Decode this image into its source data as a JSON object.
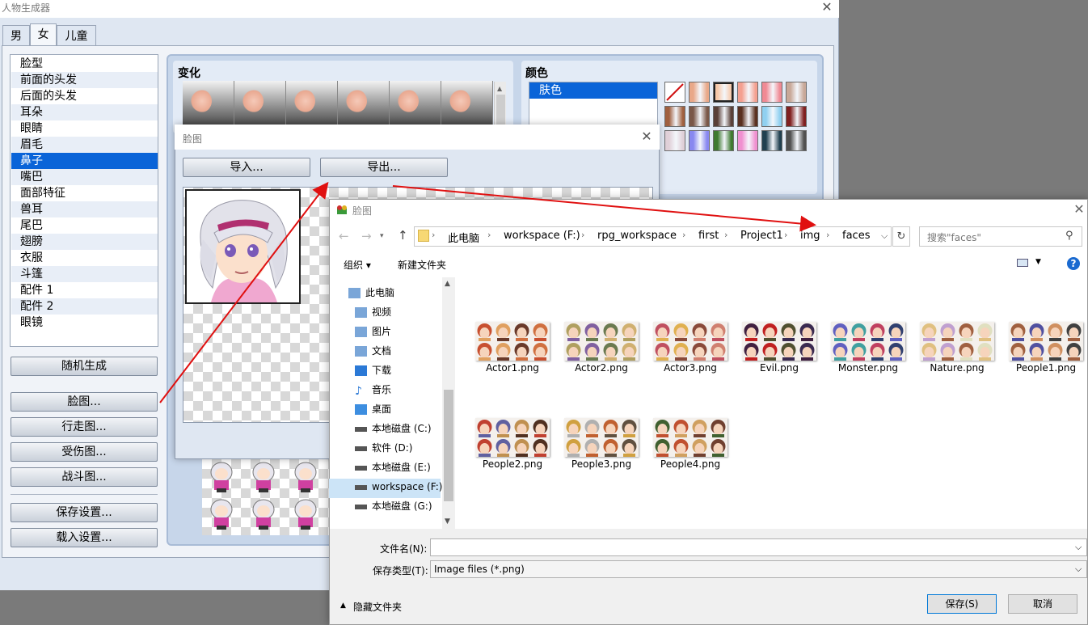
{
  "main_window": {
    "title": "人物生成器",
    "close_glyph": "✕",
    "tabs": [
      {
        "label": "男"
      },
      {
        "label": "女"
      },
      {
        "label": "儿童"
      }
    ],
    "parts": [
      "脸型",
      "前面的头发",
      "后面的头发",
      "耳朵",
      "眼睛",
      "眉毛",
      "鼻子",
      "嘴巴",
      "面部特征",
      "兽耳",
      "尾巴",
      "翅膀",
      "衣服",
      "斗篷",
      "配件 1",
      "配件 2",
      "眼镜"
    ],
    "selected_part": "鼻子",
    "buttons": {
      "random": "随机生成",
      "face": "脸图...",
      "walk": "行走图...",
      "damage": "受伤图...",
      "battle": "战斗图...",
      "save": "保存设置...",
      "load": "载入设置..."
    },
    "variation_heading": "变化",
    "color_heading": "颜色",
    "color_list_selected": "肤色",
    "swatches": [
      "#ffffff",
      "#e9a888",
      "#f7c8a8",
      "#f4a090",
      "#f08a94",
      "#c8a898",
      "#a06040",
      "#7a5848",
      "#5a4038",
      "#5a3020",
      "#90d0f0",
      "#802020",
      "#e0d0d8",
      "#8888f0",
      "#3e7a30",
      "#f090d0",
      "#204050",
      "#505050"
    ]
  },
  "face_dialog": {
    "title": "脸图",
    "close_glyph": "✕",
    "import_label": "导入...",
    "export_label": "导出..."
  },
  "file_dialog": {
    "title": "脸图",
    "close_glyph": "✕",
    "breadcrumb": [
      "此电脑",
      "workspace (F:)",
      "rpg_workspace",
      "first",
      "Project1",
      "img",
      "faces"
    ],
    "search_placeholder": "搜索\"faces\"",
    "organize": "组织 ▾",
    "new_folder": "新建文件夹",
    "nav_items": [
      {
        "label": "此电脑",
        "icon": "computer-icon"
      },
      {
        "label": "视频",
        "icon": "video-folder-icon"
      },
      {
        "label": "图片",
        "icon": "pictures-folder-icon"
      },
      {
        "label": "文档",
        "icon": "documents-folder-icon"
      },
      {
        "label": "下载",
        "icon": "download-icon"
      },
      {
        "label": "音乐",
        "icon": "music-icon"
      },
      {
        "label": "桌面",
        "icon": "desktop-icon"
      },
      {
        "label": "本地磁盘 (C:)",
        "icon": "drive-icon"
      },
      {
        "label": "软件 (D:)",
        "icon": "drive-icon"
      },
      {
        "label": "本地磁盘 (E:)",
        "icon": "drive-icon"
      },
      {
        "label": "workspace (F:)",
        "icon": "drive-icon"
      },
      {
        "label": "本地磁盘 (G:)",
        "icon": "drive-icon"
      }
    ],
    "selected_nav": "workspace (F:)",
    "files": [
      "Actor1.png",
      "Actor2.png",
      "Actor3.png",
      "Evil.png",
      "Monster.png",
      "Nature.png",
      "People1.png",
      "People2.png",
      "People3.png",
      "People4.png"
    ],
    "filename_label": "文件名(N):",
    "filename_value": "",
    "filetype_label": "保存类型(T):",
    "filetype_value": "Image files (*.png)",
    "hide_folders": "隐藏文件夹",
    "save_label": "保存(S)",
    "cancel_label": "取消"
  },
  "colors": {
    "selection_blue": "#0a64d8",
    "annotation_red": "#e01010",
    "explorer_select": "#cce4f7"
  }
}
